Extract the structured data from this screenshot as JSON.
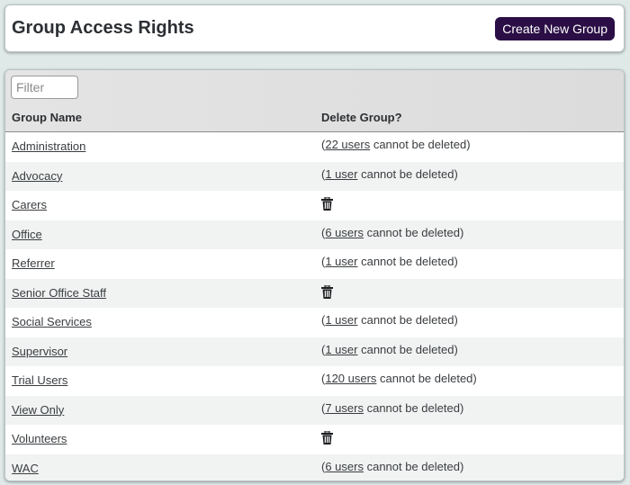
{
  "header": {
    "title": "Group Access Rights",
    "create_button_label": "Create New Group"
  },
  "table": {
    "filter_placeholder": "Filter",
    "filter_value": "",
    "columns": [
      "Group Name",
      "Delete Group?"
    ],
    "rows": [
      {
        "name": "Administration",
        "deletable": false,
        "users_link": "22 users",
        "suffix": " cannot be deleted)"
      },
      {
        "name": "Advocacy",
        "deletable": false,
        "users_link": "1 user",
        "suffix": " cannot be deleted)"
      },
      {
        "name": "Carers",
        "deletable": true,
        "icon": "trash-icon"
      },
      {
        "name": "Office",
        "deletable": false,
        "users_link": "6 users",
        "suffix": " cannot be deleted)"
      },
      {
        "name": "Referrer",
        "deletable": false,
        "users_link": "1 user",
        "suffix": " cannot be deleted)"
      },
      {
        "name": "Senior Office Staff",
        "deletable": true,
        "icon": "trash-icon"
      },
      {
        "name": "Social Services",
        "deletable": false,
        "users_link": "1 user",
        "suffix": " cannot be deleted)"
      },
      {
        "name": "Supervisor",
        "deletable": false,
        "users_link": "1 user",
        "suffix": " cannot be deleted)"
      },
      {
        "name": "Trial Users",
        "deletable": false,
        "users_link": "120 users",
        "suffix": " cannot be deleted)"
      },
      {
        "name": "View Only",
        "deletable": false,
        "users_link": "7 users",
        "suffix": " cannot be deleted)"
      },
      {
        "name": "Volunteers",
        "deletable": true,
        "icon": "trash-icon"
      },
      {
        "name": "WAC",
        "deletable": false,
        "users_link": "6 users",
        "suffix": " cannot be deleted)"
      }
    ]
  },
  "colors": {
    "button_bg": "#2a0e45",
    "page_bg": "#dfe9e8",
    "row_alt": "#f1f3f3"
  }
}
